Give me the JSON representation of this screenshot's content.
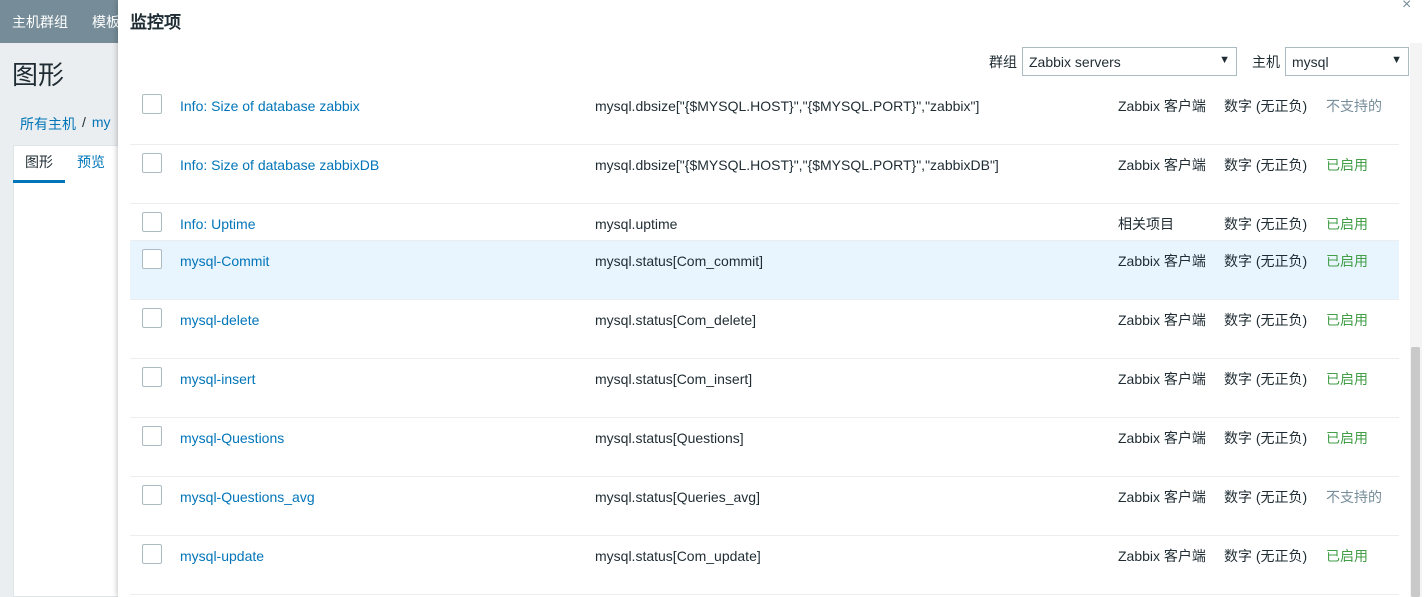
{
  "bg": {
    "nav": [
      "主机群组",
      "模板"
    ],
    "title": "图形",
    "crumb": [
      "所有主机",
      "/",
      "my"
    ],
    "tabs": [
      "图形",
      "预览"
    ]
  },
  "modal": {
    "title": "监控项",
    "close_icon": "×",
    "group_label": "群组",
    "group_value": "Zabbix servers",
    "host_label": "主机",
    "host_value": "mysql"
  },
  "colors": {
    "link": "#0275b8",
    "enabled": "#429e47",
    "unsupported": "#768d99",
    "highlight": "#e8f5ff"
  },
  "items": [
    {
      "name": "Info: Size of database zabbix",
      "key": "mysql.dbsize[\"{$MYSQL.HOST}\",\"{$MYSQL.PORT}\",\"zabbix\"]",
      "type": "Zabbix 客户端",
      "value_type": "数字 (无正负)",
      "status": "不支持的",
      "status_kind": "unsup"
    },
    {
      "name": "Info: Size of database zabbixDB",
      "key": "mysql.dbsize[\"{$MYSQL.HOST}\",\"{$MYSQL.PORT}\",\"zabbixDB\"]",
      "type": "Zabbix 客户端",
      "value_type": "数字 (无正负)",
      "status": "已启用",
      "status_kind": "enabled"
    },
    {
      "name": "Info: Uptime",
      "key": "mysql.uptime",
      "type": "相关项目",
      "value_type": "数字 (无正负)",
      "status": "已启用",
      "status_kind": "enabled"
    },
    {
      "name": "mysql-Commit",
      "key": "mysql.status[Com_commit]",
      "type": "Zabbix 客户端",
      "value_type": "数字 (无正负)",
      "status": "已启用",
      "status_kind": "enabled"
    },
    {
      "name": "mysql-delete",
      "key": "mysql.status[Com_delete]",
      "type": "Zabbix 客户端",
      "value_type": "数字 (无正负)",
      "status": "已启用",
      "status_kind": "enabled"
    },
    {
      "name": "mysql-insert",
      "key": "mysql.status[Com_insert]",
      "type": "Zabbix 客户端",
      "value_type": "数字 (无正负)",
      "status": "已启用",
      "status_kind": "enabled"
    },
    {
      "name": "mysql-Questions",
      "key": "mysql.status[Questions]",
      "type": "Zabbix 客户端",
      "value_type": "数字 (无正负)",
      "status": "已启用",
      "status_kind": "enabled"
    },
    {
      "name": "mysql-Questions_avg",
      "key": "mysql.status[Queries_avg]",
      "type": "Zabbix 客户端",
      "value_type": "数字 (无正负)",
      "status": "不支持的",
      "status_kind": "unsup"
    },
    {
      "name": "mysql-update",
      "key": "mysql.status[Com_update]",
      "type": "Zabbix 客户端",
      "value_type": "数字 (无正负)",
      "status": "已启用",
      "status_kind": "enabled"
    }
  ]
}
